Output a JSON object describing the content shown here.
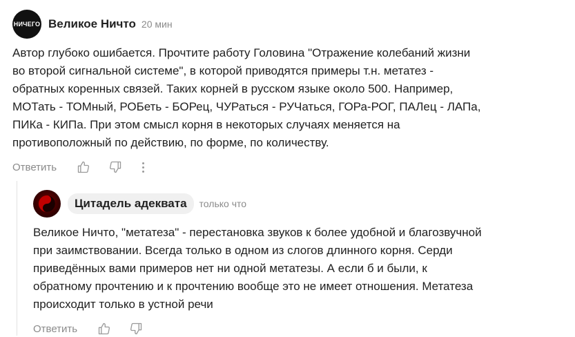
{
  "comment": {
    "avatar_text": "НИЧЕГО",
    "author": "Великое Ничто",
    "time": "20 мин",
    "text": "Автор глубоко ошибается. Прочтите работу Головина \"Отражение колебаний жизни\nво второй сигнальной системе\", в которой приводятся примеры т.н. метатез -\nобратных коренных связей. Таких корней в русском языке около 500. Например,\nМОТать - ТОМный, РОБеть - БОРец, ЧУРаться - РУЧаться, ГОРа-РОГ, ПАЛец - ЛАПа,\nПИКа - КИПа. При этом смысл корня в некоторых случаях меняется на\nпротивоположный по действию, по форме, по количеству.",
    "reply_label": "Ответить"
  },
  "reply": {
    "author": "Цитадель адеквата",
    "time": "только что",
    "text": "Великое Ничто, \"метатеза\" - перестановка звуков к более удобной и благозвучной\nпри заимствовании. Всегда только в одном из слогов длинного корня. Серди\nприведённых вами примеров нет ни одной метатезы. А если б и были, к\nобратному прочтению и к прочтению вообще это не имеет отношения. Метатеза\nпроисходит только в устной речи",
    "reply_label": "Ответить"
  },
  "icons": {
    "like": "thumbs-up-icon",
    "dislike": "thumbs-down-icon",
    "more": "more-vertical-icon",
    "reply_avatar": "yin-yang-icon"
  },
  "colors": {
    "muted": "#8a8a8a",
    "pill": "#f0f0f0",
    "avatar_main": "#111111",
    "avatar_reply": "#7a0000"
  }
}
